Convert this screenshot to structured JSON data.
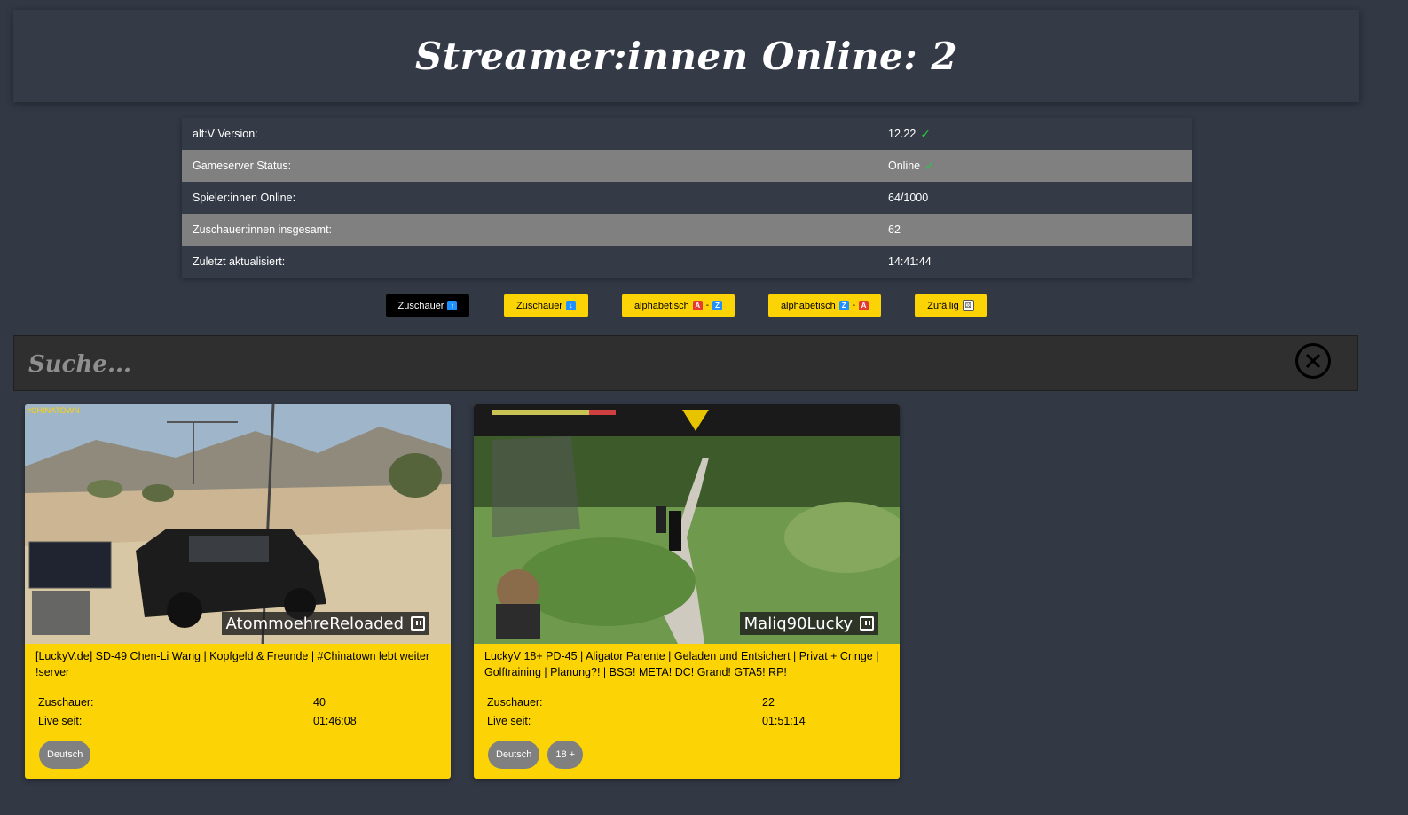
{
  "header": {
    "title": "Streamer:innen Online: 2"
  },
  "status": [
    {
      "label": "alt:V Version:",
      "value": "12.22",
      "check": true
    },
    {
      "label": "Gameserver Status:",
      "value": "Online",
      "check": true
    },
    {
      "label": "Spieler:innen Online:",
      "value": "64/1000",
      "check": false
    },
    {
      "label": "Zuschauer:innen insgesamt:",
      "value": "62",
      "check": false
    },
    {
      "label": "Zuletzt aktualisiert:",
      "value": "14:41:44",
      "check": false
    }
  ],
  "sort_buttons": [
    {
      "label": "Zuschauer",
      "keys": [
        "↑"
      ],
      "active": true
    },
    {
      "label": "Zuschauer",
      "keys": [
        "↓"
      ],
      "active": false
    },
    {
      "label": "alphabetisch",
      "keys": [
        "A",
        "Z"
      ],
      "active": false
    },
    {
      "label": "alphabetisch",
      "keys": [
        "Z",
        "A"
      ],
      "active": false
    },
    {
      "label": "Zufällig",
      "keys": [],
      "active": false
    }
  ],
  "search": {
    "placeholder": "Suche..."
  },
  "streams": [
    {
      "name": "AtommoehreReloaded",
      "title": "[LuckyV.de] SD-49 Chen-Li Wang | Kopfgeld & Freunde | #Chinatown lebt weiter !server",
      "viewers_label": "Zuschauer:",
      "viewers": "40",
      "live_label": "Live seit:",
      "live_since": "01:46:08",
      "tags": [
        "Deutsch"
      ],
      "overlay_text": "#CHINATOWN"
    },
    {
      "name": "Maliq90Lucky",
      "title": "LuckyV 18+ PD-45 | Aligator Parente | Geladen und Entsichert | Privat + Cringe | Golftraining | Planung?! | BSG! META! DC! Grand! GTA5! RP!",
      "viewers_label": "Zuschauer:",
      "viewers": "22",
      "live_label": "Live seit:",
      "live_since": "01:51:14",
      "tags": [
        "Deutsch",
        "18 +"
      ],
      "overlay_text": ""
    }
  ]
}
